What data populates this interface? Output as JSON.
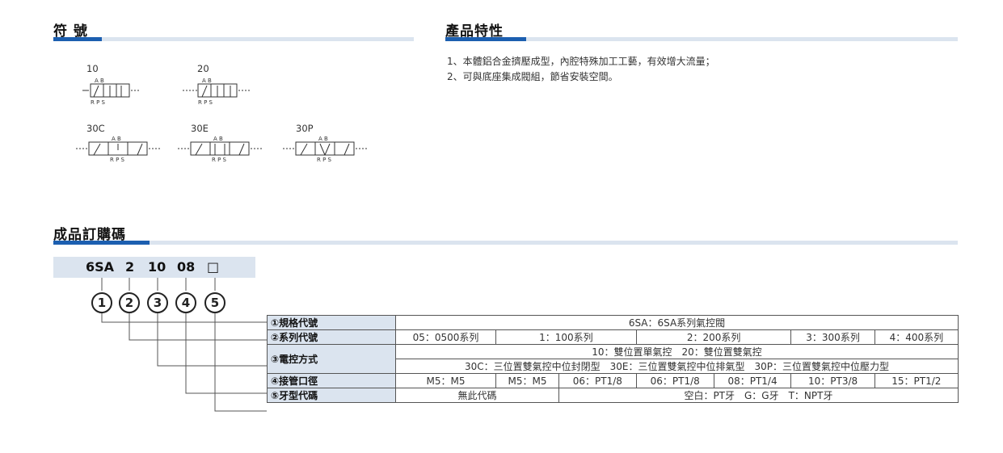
{
  "sections": {
    "symbols_title": "符 號",
    "features_title": "產品特性",
    "order_title": "成品訂購碼"
  },
  "features": [
    "1、本體鋁合金擠壓成型，內腔特殊加工工藝，有效增大流量；",
    "2、可與底座集成閥組，節省安裝空間。"
  ],
  "symbols": {
    "s10": "10",
    "s20": "20",
    "s30c": "30C",
    "s30e": "30E",
    "s30p": "30P",
    "port_ab": "A B",
    "port_rps": "R P S"
  },
  "order_code": {
    "model": "6SA",
    "series": "2",
    "control": "10",
    "port": "08",
    "thread": "□",
    "numbers": [
      "1",
      "2",
      "3",
      "4",
      "5"
    ]
  },
  "spec_table": {
    "row1": {
      "label": "①規格代號",
      "value": "6SA：6SA系列氣控閥"
    },
    "row2": {
      "label": "②系列代號",
      "cells": [
        "05：0500系列",
        "1：100系列",
        "2：200系列",
        "3：300系列",
        "4：400系列"
      ]
    },
    "row3": {
      "label": "③電控方式",
      "line1": "10：雙位置單氣控　20：雙位置雙氣控",
      "line2": "30C：三位置雙氣控中位封閉型　30E：三位置雙氣控中位排氣型　30P：三位置雙氣控中位壓力型"
    },
    "row4": {
      "label": "④接管口徑",
      "cells": [
        "M5：M5",
        "M5：M5",
        "06：PT1/8",
        "06：PT1/8",
        "08：PT1/4",
        "10：PT3/8",
        "15：PT1/2"
      ]
    },
    "row5": {
      "label": "⑤牙型代碼",
      "cells": [
        "無此代碼",
        "空白：PT牙　G：G牙　T：NPT牙"
      ]
    }
  },
  "colors": {
    "accent": "#1c5fb0",
    "bar": "#dbe4ef"
  }
}
